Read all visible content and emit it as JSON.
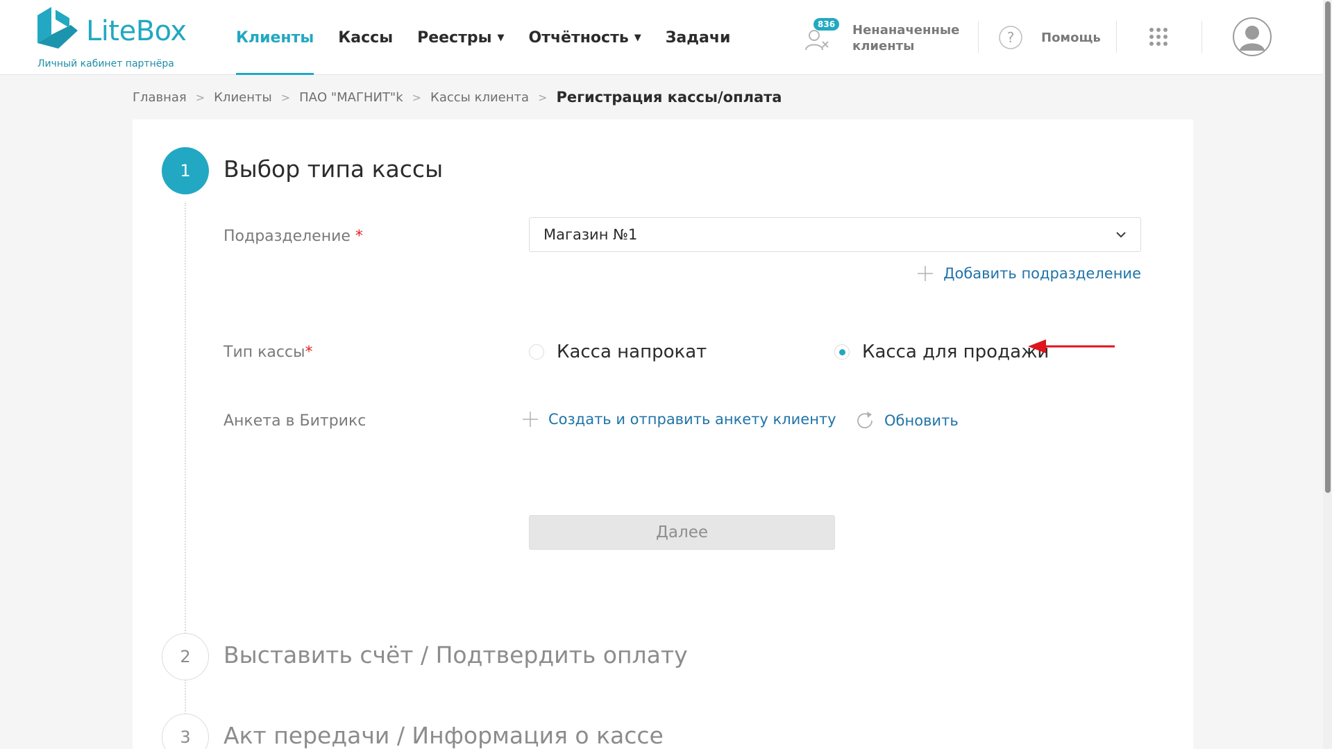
{
  "header": {
    "logo_text": "LiteBox",
    "logo_subtitle": "Личный кабинет партнёра",
    "nav": [
      {
        "label": "Клиенты",
        "active": true
      },
      {
        "label": "Кассы"
      },
      {
        "label": "Реестры",
        "dropdown": true
      },
      {
        "label": "Отчётность",
        "dropdown": true
      },
      {
        "label": "Задачи"
      }
    ],
    "unassigned": {
      "count": "836",
      "label": "Ненаначенные клиенты"
    },
    "help_label": "Помощь",
    "icons": {
      "unassigned": "user-remove-icon",
      "help": "question-circle-icon",
      "apps": "grid-icon",
      "avatar": "user-avatar-icon"
    }
  },
  "breadcrumb": {
    "items": [
      "Главная",
      "Клиенты",
      "ПАО \"МАГНИТ\"k",
      "Кассы клиента"
    ],
    "current": "Регистрация кассы/оплата"
  },
  "steps": [
    {
      "number": "1",
      "title": "Выбор типа кассы",
      "active": true
    },
    {
      "number": "2",
      "title": "Выставить счёт / Подтвердить оплату",
      "active": false
    },
    {
      "number": "3",
      "title": "Акт передачи / Информация о кассе",
      "active": false
    }
  ],
  "form": {
    "division": {
      "label": "Подразделение",
      "required_mark": "*",
      "value": "Магазин №1"
    },
    "add_division_label": "Добавить подразделение",
    "cash_type": {
      "label": "Тип кассы",
      "required_mark": "*",
      "options": [
        {
          "label": "Касса напрокат",
          "checked": false
        },
        {
          "label": "Касса для продажи",
          "checked": true
        }
      ]
    },
    "bitrix": {
      "label": "Анкета в Битрикс",
      "create_label": "Создать и отправить анкету клиенту",
      "refresh_label": "Обновить"
    },
    "next_label": "Далее"
  },
  "colors": {
    "accent": "#22a8c2",
    "link": "#1f73a8",
    "required": "#e02424",
    "annotation_arrow": "#e0141c"
  }
}
